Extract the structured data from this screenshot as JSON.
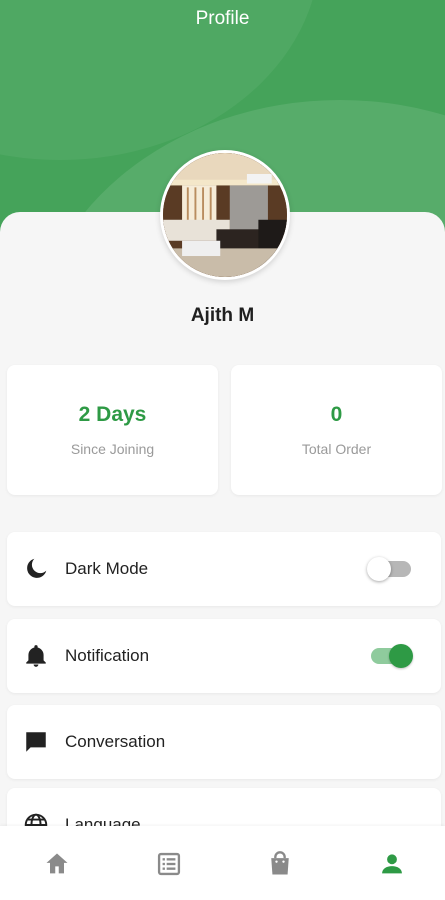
{
  "header": {
    "title": "Profile"
  },
  "user": {
    "name": "Ajith M"
  },
  "stats": [
    {
      "value": "2 Days",
      "label": "Since Joining"
    },
    {
      "value": "0",
      "label": "Total Order"
    }
  ],
  "settings": [
    {
      "label": "Dark Mode",
      "icon": "moon-icon",
      "toggle": "off"
    },
    {
      "label": "Notification",
      "icon": "bell-icon",
      "toggle": "on"
    },
    {
      "label": "Conversation",
      "icon": "chat-icon"
    },
    {
      "label": "Language",
      "icon": "globe-icon"
    }
  ],
  "bottom_nav": [
    {
      "icon": "home-icon",
      "active": false
    },
    {
      "icon": "orders-list-icon",
      "active": false
    },
    {
      "icon": "shopping-bag-icon",
      "active": false
    },
    {
      "icon": "person-icon",
      "active": true
    }
  ],
  "colors": {
    "primary": "#45a35a",
    "accent_text": "#2e9a45",
    "nav_inactive": "#8a8a8a"
  }
}
